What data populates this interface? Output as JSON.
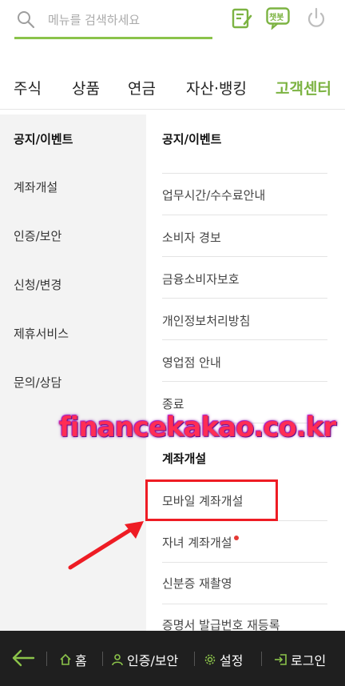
{
  "search": {
    "placeholder": "메뉴를 검색하세요"
  },
  "top_icons": {
    "chatbot_label": "챗봇"
  },
  "gnb": [
    "주식",
    "상품",
    "연금",
    "자산·뱅킹",
    "고객센터"
  ],
  "lnb": [
    "공지/이벤트",
    "계좌개설",
    "인증/보안",
    "신청/변경",
    "제휴서비스",
    "문의/상담"
  ],
  "content": {
    "header": "공지/이벤트",
    "items": [
      "업무시간/수수료안내",
      "소비자 경보",
      "금융소비자보호",
      "개인정보처리방침",
      "영업점 안내",
      "종료"
    ],
    "section": "계좌개설",
    "section_items": [
      "모바일 계좌개설",
      "자녀 계좌개설",
      "신분증 재촬영",
      "증명서 발급번호 재등록"
    ]
  },
  "watermark": "financekakao.co.kr",
  "bottom": {
    "home": "홈",
    "auth": "인증/보안",
    "settings": "설정",
    "login": "로그인"
  },
  "colors": {
    "accent": "#7cb342",
    "highlight": "#ee1c24",
    "bottom_bg": "#1f1f1f"
  }
}
